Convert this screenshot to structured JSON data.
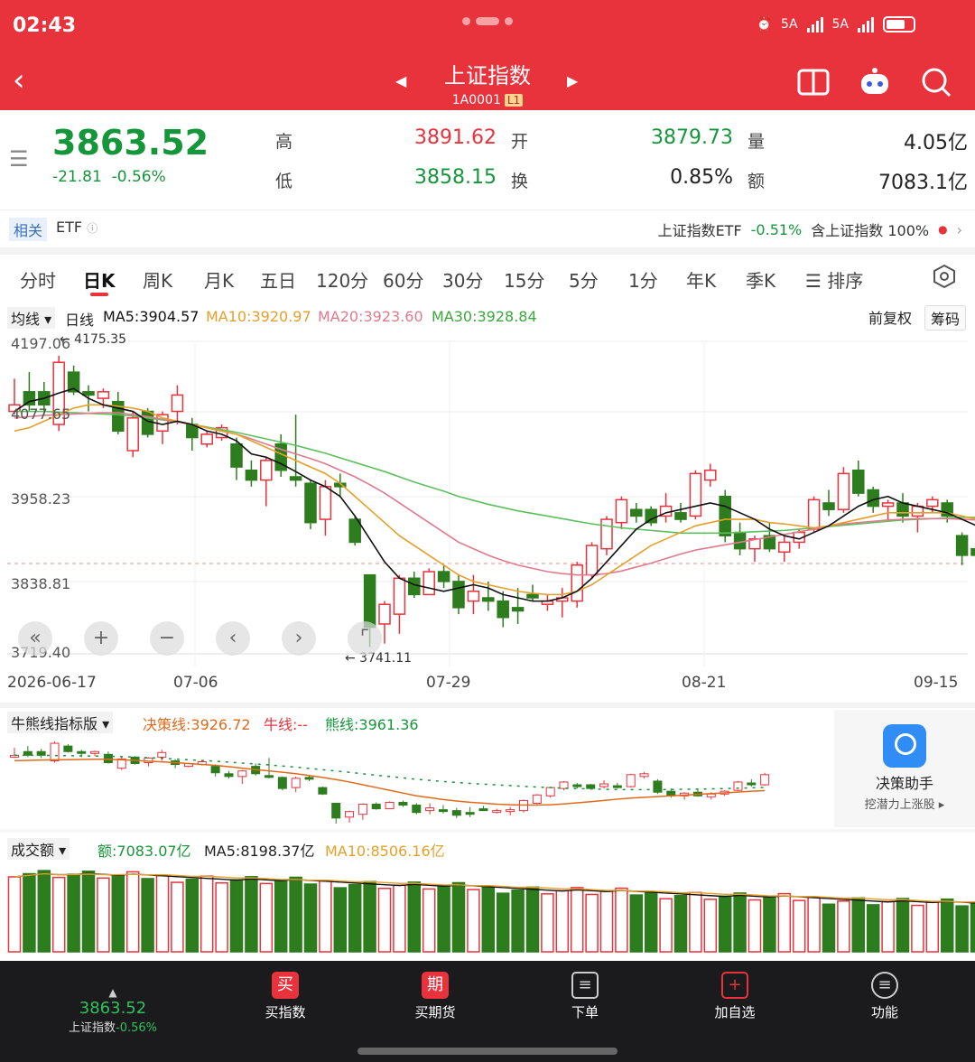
{
  "status": {
    "time": "02:43",
    "net1": "5A",
    "net2": "5A"
  },
  "header": {
    "title": "上证指数",
    "code": "1A0001",
    "level": "L1"
  },
  "quote": {
    "price": "3863.52",
    "change": "-21.81",
    "change_pct": "-0.56%",
    "labels": {
      "high": "高",
      "low": "低",
      "open": "开",
      "turnover": "换",
      "volume": "量",
      "amount": "额"
    },
    "high": "3891.62",
    "low": "3858.15",
    "open": "3879.73",
    "turnover": "0.85%",
    "volume": "4.05亿",
    "amount": "7083.1亿"
  },
  "etf": {
    "tag": "相关",
    "label": "ETF",
    "name": "上证指数ETF",
    "pct": "-0.51%",
    "holding": "含上证指数 100%"
  },
  "tabs": [
    "分时",
    "日K",
    "周K",
    "月K",
    "五日",
    "120分",
    "60分",
    "30分",
    "15分",
    "5分",
    "1分",
    "年K",
    "季K",
    "☰ 排序"
  ],
  "ma": {
    "selector": "均线 ▾",
    "line_type": "日线",
    "ma5": "MA5:3904.57",
    "ma10": "MA10:3920.97",
    "ma20": "MA20:3923.60",
    "ma30": "MA30:3928.84",
    "adjust": "前复权",
    "chips": "筹码"
  },
  "chart_data": {
    "type": "candlestick",
    "y_ticks": [
      "4197.06",
      "4077.65",
      "3958.23",
      "3838.81",
      "3719.40"
    ],
    "ylim": [
      3719.4,
      4197.06
    ],
    "annotations": {
      "high": "← 4175.35",
      "low": "← 3741.11"
    },
    "dates": [
      "2026-06-17",
      "07-06",
      "07-29",
      "08-21",
      "09-15"
    ],
    "candles": [
      [
        4090,
        4140,
        4085,
        4100
      ],
      [
        4120,
        4150,
        4090,
        4100
      ],
      [
        4120,
        4135,
        4085,
        4100
      ],
      [
        4070,
        4175,
        4060,
        4165
      ],
      [
        4150,
        4160,
        4115,
        4120
      ],
      [
        4120,
        4130,
        4090,
        4115
      ],
      [
        4110,
        4125,
        4095,
        4120
      ],
      [
        4105,
        4120,
        4055,
        4060
      ],
      [
        4030,
        4090,
        4020,
        4080
      ],
      [
        4090,
        4095,
        4050,
        4055
      ],
      [
        4060,
        4090,
        4040,
        4085
      ],
      [
        4090,
        4130,
        4070,
        4115
      ],
      [
        4070,
        4080,
        4030,
        4050
      ],
      [
        4040,
        4060,
        4035,
        4055
      ],
      [
        4050,
        4070,
        4045,
        4065
      ],
      [
        4040,
        4050,
        3985,
        4005
      ],
      [
        4000,
        4015,
        3975,
        3985
      ],
      [
        3985,
        4020,
        3945,
        4015
      ],
      [
        4040,
        4055,
        3990,
        4000
      ],
      [
        3990,
        4085,
        3975,
        3985
      ],
      [
        3980,
        3985,
        3910,
        3920
      ],
      [
        3925,
        3985,
        3900,
        3975
      ],
      [
        3980,
        3995,
        3960,
        3975
      ],
      [
        3925,
        3930,
        3885,
        3890
      ],
      [
        3840,
        3840,
        3730,
        3760
      ],
      [
        3765,
        3800,
        3735,
        3795
      ],
      [
        3780,
        3840,
        3750,
        3835
      ],
      [
        3835,
        3845,
        3805,
        3810
      ],
      [
        3810,
        3850,
        3810,
        3845
      ],
      [
        3845,
        3855,
        3820,
        3830
      ],
      [
        3830,
        3840,
        3780,
        3790
      ],
      [
        3800,
        3840,
        3780,
        3815
      ],
      [
        3805,
        3830,
        3785,
        3800
      ],
      [
        3800,
        3815,
        3760,
        3775
      ],
      [
        3790,
        3820,
        3765,
        3785
      ],
      [
        3810,
        3825,
        3800,
        3805
      ],
      [
        3795,
        3810,
        3785,
        3800
      ],
      [
        3800,
        3820,
        3775,
        3805
      ],
      [
        3800,
        3860,
        3790,
        3855
      ],
      [
        3840,
        3890,
        3835,
        3885
      ],
      [
        3880,
        3930,
        3870,
        3925
      ],
      [
        3920,
        3960,
        3910,
        3955
      ],
      [
        3940,
        3950,
        3920,
        3930
      ],
      [
        3940,
        3945,
        3915,
        3920
      ],
      [
        3930,
        3965,
        3920,
        3945
      ],
      [
        3935,
        3950,
        3920,
        3925
      ],
      [
        3930,
        4000,
        3925,
        3995
      ],
      [
        3985,
        4010,
        3975,
        4000
      ],
      [
        3960,
        3970,
        3890,
        3900
      ],
      [
        3905,
        3920,
        3870,
        3880
      ],
      [
        3880,
        3900,
        3860,
        3895
      ],
      [
        3900,
        3920,
        3875,
        3880
      ],
      [
        3875,
        3900,
        3860,
        3890
      ],
      [
        3890,
        3910,
        3880,
        3905
      ],
      [
        3910,
        3960,
        3905,
        3955
      ],
      [
        3950,
        3970,
        3930,
        3940
      ],
      [
        3940,
        4005,
        3935,
        3995
      ],
      [
        4000,
        4015,
        3960,
        3965
      ],
      [
        3970,
        3975,
        3935,
        3945
      ],
      [
        3945,
        3955,
        3925,
        3950
      ],
      [
        3950,
        3965,
        3920,
        3930
      ],
      [
        3930,
        3950,
        3905,
        3945
      ],
      [
        3945,
        3960,
        3935,
        3955
      ],
      [
        3950,
        3955,
        3920,
        3930
      ],
      [
        3900,
        3905,
        3855,
        3870
      ],
      [
        3880,
        3895,
        3865,
        3870
      ],
      [
        3880,
        3890,
        3860,
        3875
      ]
    ],
    "ma5": [
      4090,
      4105,
      4110,
      4118,
      4125,
      4110,
      4100,
      4095,
      4090,
      4075,
      4070,
      4075,
      4070,
      4060,
      4055,
      4045,
      4025,
      4020,
      4010,
      3998,
      3985,
      3975,
      3960,
      3930,
      3895,
      3860,
      3835,
      3825,
      3820,
      3815,
      3820,
      3825,
      3820,
      3810,
      3805,
      3800,
      3800,
      3805,
      3815,
      3835,
      3860,
      3885,
      3910,
      3925,
      3935,
      3940,
      3945,
      3950,
      3945,
      3935,
      3925,
      3910,
      3900,
      3895,
      3905,
      3915,
      3930,
      3945,
      3955,
      3960,
      3950,
      3945,
      3940,
      3935,
      3925,
      3915,
      3905
    ],
    "ma10": [
      4060,
      4065,
      4075,
      4085,
      4095,
      4100,
      4100,
      4098,
      4095,
      4090,
      4080,
      4075,
      4070,
      4065,
      4060,
      4055,
      4045,
      4035,
      4025,
      4015,
      4005,
      3995,
      3980,
      3960,
      3940,
      3920,
      3900,
      3885,
      3870,
      3855,
      3840,
      3830,
      3825,
      3820,
      3815,
      3812,
      3810,
      3810,
      3815,
      3825,
      3840,
      3855,
      3870,
      3885,
      3895,
      3905,
      3915,
      3920,
      3925,
      3925,
      3925,
      3920,
      3918,
      3915,
      3912,
      3915,
      3920,
      3925,
      3930,
      3935,
      3935,
      3935,
      3935,
      3935,
      3930,
      3925,
      3920
    ],
    "ma20": [
      4080,
      4082,
      4084,
      4085,
      4086,
      4087,
      4088,
      4088,
      4085,
      4082,
      4078,
      4074,
      4070,
      4065,
      4060,
      4055,
      4048,
      4040,
      4032,
      4025,
      4018,
      4010,
      4000,
      3990,
      3978,
      3965,
      3950,
      3935,
      3920,
      3905,
      3890,
      3880,
      3870,
      3862,
      3855,
      3850,
      3845,
      3842,
      3840,
      3840,
      3842,
      3846,
      3852,
      3858,
      3865,
      3872,
      3878,
      3882,
      3886,
      3890,
      3894,
      3898,
      3902,
      3906,
      3910,
      3915,
      3918,
      3920,
      3922,
      3924,
      3925,
      3926,
      3926,
      3926,
      3925,
      3924,
      3923
    ],
    "ma30": [
      4090,
      4090,
      4090,
      4089,
      4088,
      4087,
      4086,
      4085,
      4083,
      4080,
      4077,
      4074,
      4070,
      4066,
      4062,
      4058,
      4053,
      4048,
      4043,
      4038,
      4032,
      4026,
      4019,
      4012,
      4005,
      3998,
      3990,
      3982,
      3975,
      3968,
      3960,
      3954,
      3948,
      3943,
      3938,
      3934,
      3930,
      3926,
      3922,
      3918,
      3915,
      3912,
      3910,
      3908,
      3906,
      3904,
      3904,
      3904,
      3904,
      3905,
      3906,
      3907,
      3908,
      3910,
      3912,
      3914,
      3916,
      3918,
      3920,
      3922,
      3924,
      3925,
      3926,
      3927,
      3928,
      3928,
      3929
    ]
  },
  "bull": {
    "selector": "牛熊线指标版 ▾",
    "decision": "决策线:3926.72",
    "bull": "牛线:--",
    "bear": "熊线:3961.36"
  },
  "assistant": {
    "title": "决策助手",
    "sub": "挖潜力上涨股 ▸"
  },
  "volume": {
    "selector": "成交额 ▾",
    "amount": "额:7083.07亿",
    "ma5": "MA5:8198.37亿",
    "ma10": "MA10:8506.16亿"
  },
  "bottom": {
    "price": "3863.52",
    "name": "上证指数",
    "pct": "-0.56%",
    "items": [
      {
        "label": "买指数",
        "icon": "买"
      },
      {
        "label": "买期货",
        "icon": "期"
      },
      {
        "label": "下单",
        "icon": "≡"
      },
      {
        "label": "加自选",
        "icon": "+"
      },
      {
        "label": "功能",
        "icon": "≡"
      }
    ]
  },
  "colors": {
    "up": "#e8323c",
    "down": "#2d7d1e",
    "ma5": "#111111",
    "ma10": "#e5a02a",
    "ma20": "#e07a8c",
    "ma30": "#5cc05c",
    "header": "#e8323c"
  }
}
